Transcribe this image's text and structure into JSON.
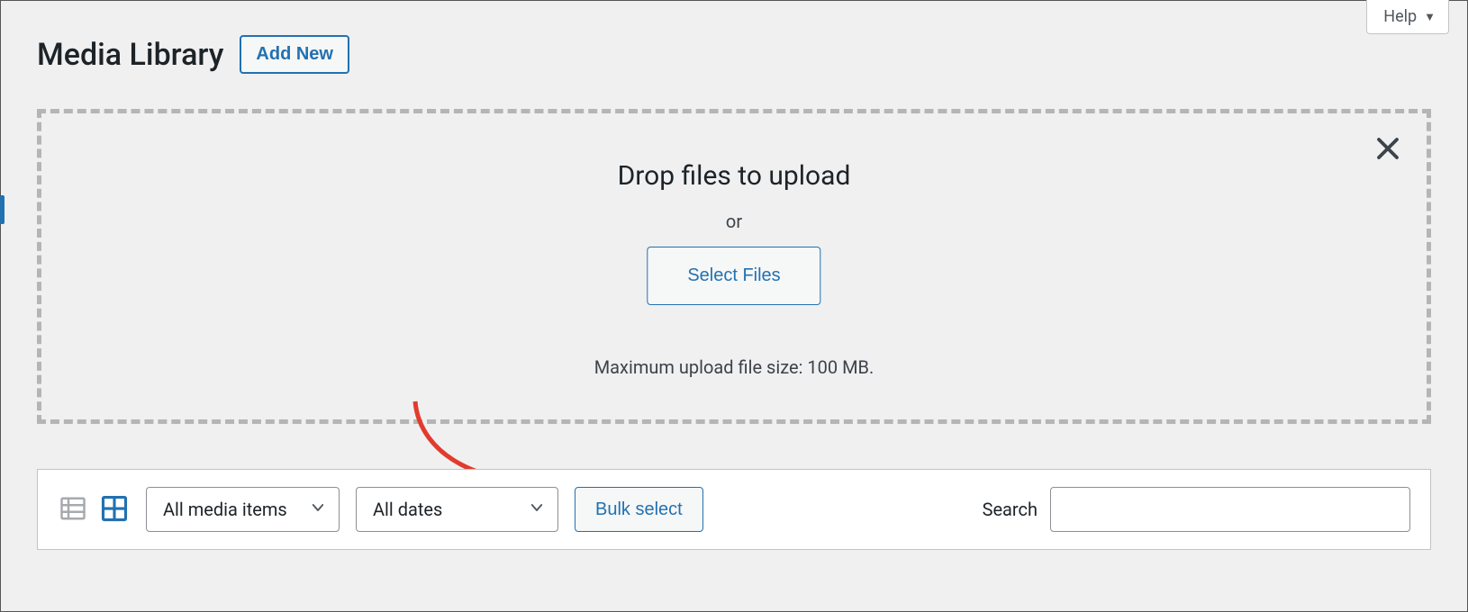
{
  "help": {
    "label": "Help"
  },
  "header": {
    "page_title": "Media Library",
    "add_new": "Add New"
  },
  "dropzone": {
    "title": "Drop files to upload",
    "or": "or",
    "select_files": "Select Files",
    "max_size": "Maximum upload file size: 100 MB."
  },
  "toolbar": {
    "media_filter": "All media items",
    "date_filter": "All dates",
    "bulk_select": "Bulk select",
    "search_label": "Search",
    "search_value": ""
  }
}
